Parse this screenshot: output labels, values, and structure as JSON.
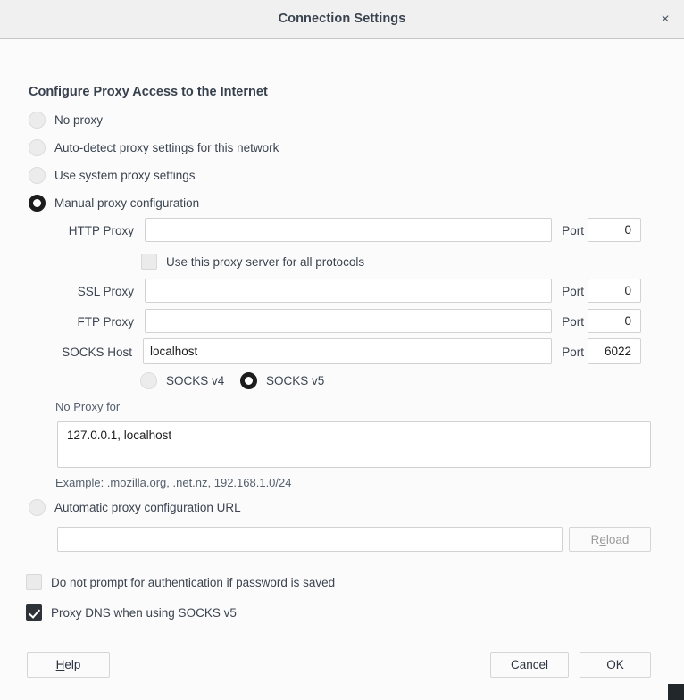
{
  "window": {
    "title": "Connection Settings",
    "close_icon": "close-icon",
    "close_glyph": "×"
  },
  "main": {
    "heading": "Configure Proxy Access to the Internet",
    "proxy_modes": [
      {
        "label": "No proxy",
        "selected": false
      },
      {
        "label": "Auto-detect proxy settings for this network",
        "selected": false
      },
      {
        "label": "Use system proxy settings",
        "selected": false
      },
      {
        "label": "Manual proxy configuration",
        "selected": true
      }
    ],
    "manual": {
      "http": {
        "label": "HTTP Proxy",
        "value": "",
        "port_label": "Port",
        "port_value": "0"
      },
      "use_for_all": {
        "label": "Use this proxy server for all protocols",
        "checked": false
      },
      "ssl": {
        "label": "SSL Proxy",
        "value": "",
        "port_label": "Port",
        "port_value": "0"
      },
      "ftp": {
        "label": "FTP Proxy",
        "value": "",
        "port_label": "Port",
        "port_value": "0"
      },
      "socks": {
        "label": "SOCKS Host",
        "value": "localhost",
        "port_label": "Port",
        "port_value": "6022"
      },
      "socks_versions": [
        {
          "label": "SOCKS v4",
          "selected": false
        },
        {
          "label": "SOCKS v5",
          "selected": true
        }
      ],
      "no_proxy": {
        "label": "No Proxy for",
        "value": "127.0.0.1, localhost",
        "example": "Example: .mozilla.org, .net.nz, 192.168.1.0/24"
      }
    },
    "auto_url": {
      "label": "Automatic proxy configuration URL",
      "selected": false,
      "value": "",
      "reload_label_prefix": "R",
      "reload_label_mnemonic": "e",
      "reload_label_suffix": "load",
      "reload_disabled": true
    },
    "options": [
      {
        "label": "Do not prompt for authentication if password is saved",
        "checked": false
      },
      {
        "label": "Proxy DNS when using SOCKS v5",
        "checked": true
      }
    ]
  },
  "footer": {
    "help": {
      "prefix": "",
      "mnemonic": "H",
      "suffix": "elp"
    },
    "cancel_label": "Cancel",
    "ok_label": "OK"
  },
  "colors": {
    "titlebar_bg": "#f0f0f0",
    "body_bg": "#fbfbfb",
    "text": "#3b4450",
    "field_border": "#d2d2d2",
    "checked_fill": "#2d3238"
  }
}
